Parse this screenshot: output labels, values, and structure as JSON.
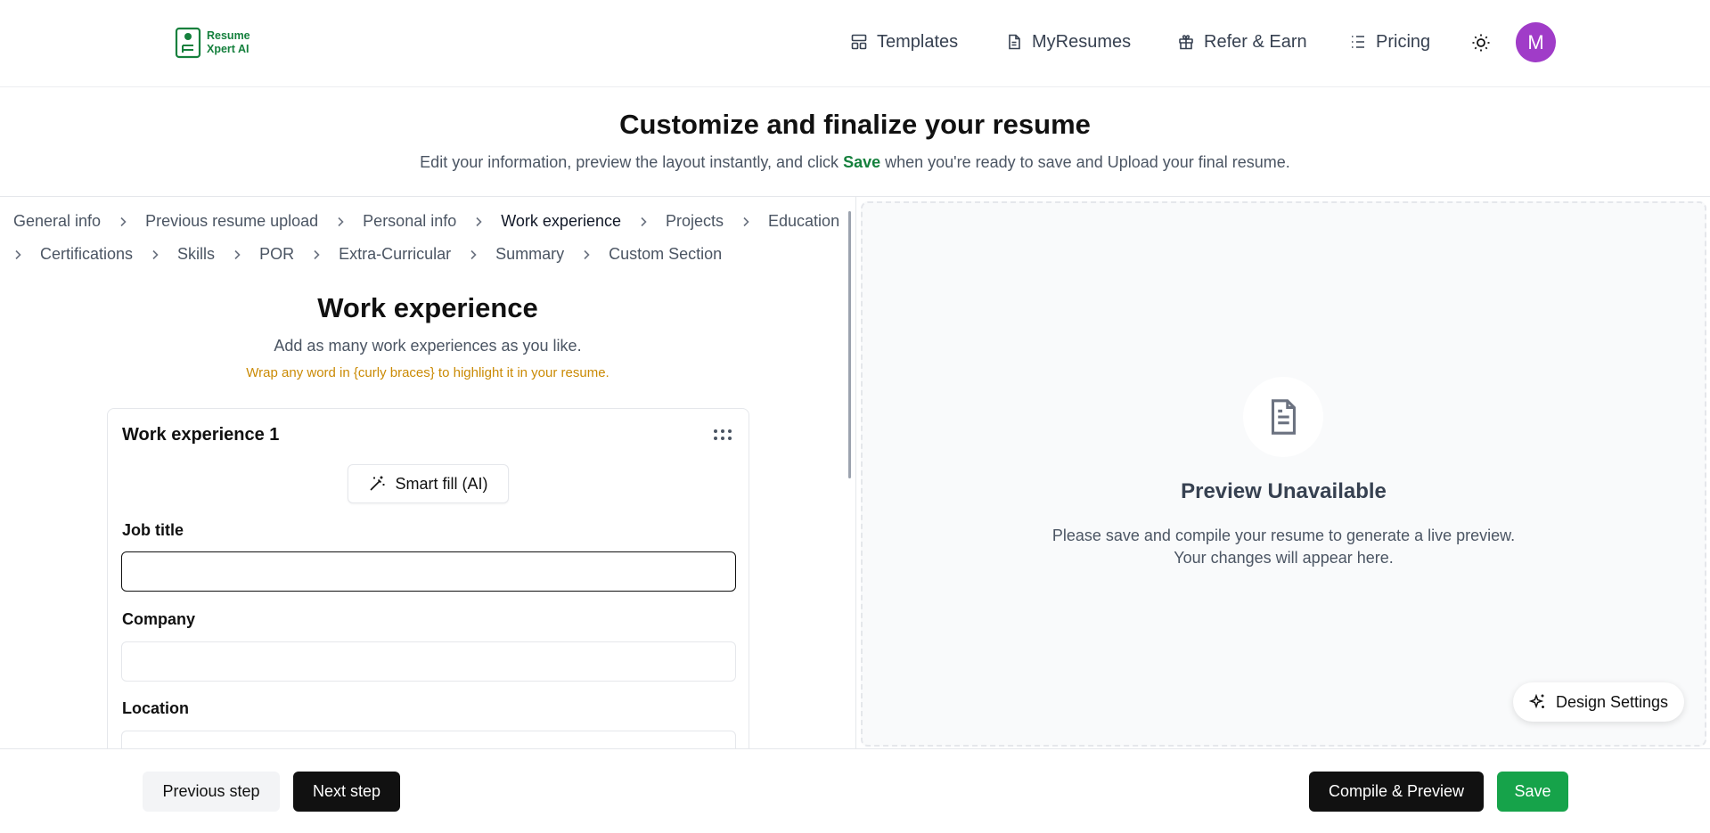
{
  "header": {
    "logo_line1": "Resume",
    "logo_line2": "Xpert AI",
    "nav": [
      {
        "label": "Templates",
        "icon": "layout-icon"
      },
      {
        "label": "MyResumes",
        "icon": "document-icon"
      },
      {
        "label": "Refer & Earn",
        "icon": "gift-icon"
      },
      {
        "label": "Pricing",
        "icon": "list-icon"
      }
    ],
    "avatar_initial": "M"
  },
  "intro": {
    "title": "Customize and finalize your resume",
    "subtitle_before": "Edit your information, preview the layout instantly, and click ",
    "subtitle_save": "Save",
    "subtitle_after": " when you're ready to save and Upload your final resume."
  },
  "steps": {
    "row1": [
      "General info",
      "Previous resume upload",
      "Personal info",
      "Work experience",
      "Projects",
      "Education"
    ],
    "row2": [
      "Certifications",
      "Skills",
      "POR",
      "Extra-Curricular",
      "Summary",
      "Custom Section"
    ],
    "active": "Work experience"
  },
  "section": {
    "title": "Work experience",
    "subtitle": "Add as many work experiences as you like.",
    "hint": "Wrap any word in {curly braces} to highlight it in your resume."
  },
  "card": {
    "title": "Work experience 1",
    "smart_fill_label": "Smart fill (AI)",
    "fields": {
      "job_title_label": "Job title",
      "job_title_value": "",
      "company_label": "Company",
      "company_value": "",
      "location_label": "Location",
      "location_value": ""
    }
  },
  "preview": {
    "title": "Preview Unavailable",
    "line1": "Please save and compile your resume to generate a live preview.",
    "line2": "Your changes will appear here.",
    "design_settings_label": "Design Settings"
  },
  "footer": {
    "previous_label": "Previous step",
    "next_label": "Next step",
    "compile_label": "Compile & Preview",
    "save_label": "Save"
  },
  "colors": {
    "brand_green": "#15803d",
    "save_green": "#16a34a",
    "hint_amber": "#ca8a04",
    "avatar_purple": "#a03cc8"
  }
}
